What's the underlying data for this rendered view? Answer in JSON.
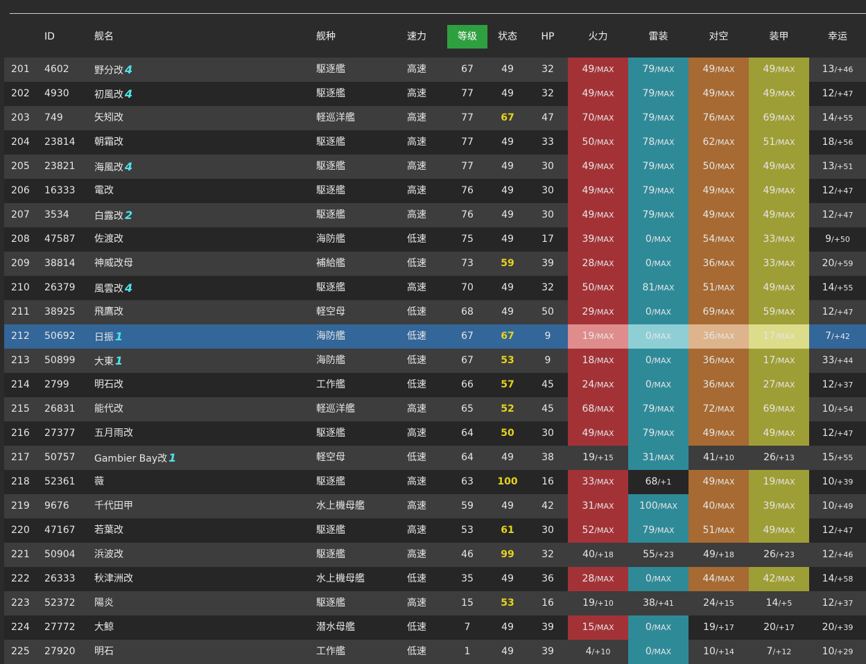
{
  "header": {
    "num": "",
    "id": "ID",
    "name": "舰名",
    "type": "舰种",
    "speed": "速力",
    "level": "等级",
    "cond": "状态",
    "hp": "HP",
    "fire": "火力",
    "torpedo": "雷装",
    "aa": "对空",
    "armor": "装甲",
    "luck": "幸运"
  },
  "colors": {
    "firepower": "#a33237",
    "torpedo": "#2f8a98",
    "antiair": "#a66a32",
    "armor": "#9e9e36",
    "selected_row": "#336699",
    "sorted_header": "#2fa040",
    "highlight_condition": "#e6d21c",
    "remodel_rank": "#4fe3e9"
  },
  "rows": [
    {
      "no": "201",
      "id": "4602",
      "name": "野分改",
      "rank": "4",
      "type": "駆逐艦",
      "speed": "高速",
      "lv": "67",
      "cond": "49",
      "hp": "32",
      "fire": [
        "49",
        "/MAX"
      ],
      "tor": [
        "79",
        "/MAX"
      ],
      "aa": [
        "49",
        "/MAX"
      ],
      "arm": [
        "49",
        "/MAX"
      ],
      "luck": [
        "13",
        "/+46"
      ],
      "hl": [
        1,
        1,
        1,
        1
      ]
    },
    {
      "no": "202",
      "id": "4930",
      "name": "初風改",
      "rank": "4",
      "type": "駆逐艦",
      "speed": "高速",
      "lv": "77",
      "cond": "49",
      "hp": "32",
      "fire": [
        "49",
        "/MAX"
      ],
      "tor": [
        "79",
        "/MAX"
      ],
      "aa": [
        "49",
        "/MAX"
      ],
      "arm": [
        "49",
        "/MAX"
      ],
      "luck": [
        "12",
        "/+47"
      ],
      "hl": [
        1,
        1,
        1,
        1
      ]
    },
    {
      "no": "203",
      "id": "749",
      "name": "矢矧改",
      "rank": "",
      "type": "軽巡洋艦",
      "speed": "高速",
      "lv": "77",
      "cond": "67",
      "hp": "47",
      "fire": [
        "70",
        "/MAX"
      ],
      "tor": [
        "79",
        "/MAX"
      ],
      "aa": [
        "76",
        "/MAX"
      ],
      "arm": [
        "69",
        "/MAX"
      ],
      "luck": [
        "14",
        "/+55"
      ],
      "hl": [
        1,
        1,
        1,
        1
      ]
    },
    {
      "no": "204",
      "id": "23814",
      "name": "朝霜改",
      "rank": "",
      "type": "駆逐艦",
      "speed": "高速",
      "lv": "77",
      "cond": "49",
      "hp": "33",
      "fire": [
        "50",
        "/MAX"
      ],
      "tor": [
        "78",
        "/MAX"
      ],
      "aa": [
        "62",
        "/MAX"
      ],
      "arm": [
        "51",
        "/MAX"
      ],
      "luck": [
        "18",
        "/+56"
      ],
      "hl": [
        1,
        1,
        1,
        1
      ]
    },
    {
      "no": "205",
      "id": "23821",
      "name": "海風改",
      "rank": "4",
      "type": "駆逐艦",
      "speed": "高速",
      "lv": "77",
      "cond": "49",
      "hp": "30",
      "fire": [
        "49",
        "/MAX"
      ],
      "tor": [
        "79",
        "/MAX"
      ],
      "aa": [
        "50",
        "/MAX"
      ],
      "arm": [
        "49",
        "/MAX"
      ],
      "luck": [
        "13",
        "/+51"
      ],
      "hl": [
        1,
        1,
        1,
        1
      ]
    },
    {
      "no": "206",
      "id": "16333",
      "name": "電改",
      "rank": "",
      "type": "駆逐艦",
      "speed": "高速",
      "lv": "76",
      "cond": "49",
      "hp": "30",
      "fire": [
        "49",
        "/MAX"
      ],
      "tor": [
        "79",
        "/MAX"
      ],
      "aa": [
        "49",
        "/MAX"
      ],
      "arm": [
        "49",
        "/MAX"
      ],
      "luck": [
        "12",
        "/+47"
      ],
      "hl": [
        1,
        1,
        1,
        1
      ]
    },
    {
      "no": "207",
      "id": "3534",
      "name": "白露改",
      "rank": "2",
      "type": "駆逐艦",
      "speed": "高速",
      "lv": "76",
      "cond": "49",
      "hp": "30",
      "fire": [
        "49",
        "/MAX"
      ],
      "tor": [
        "79",
        "/MAX"
      ],
      "aa": [
        "49",
        "/MAX"
      ],
      "arm": [
        "49",
        "/MAX"
      ],
      "luck": [
        "12",
        "/+47"
      ],
      "hl": [
        1,
        1,
        1,
        1
      ]
    },
    {
      "no": "208",
      "id": "47587",
      "name": "佐渡改",
      "rank": "",
      "type": "海防艦",
      "speed": "低速",
      "lv": "75",
      "cond": "49",
      "hp": "17",
      "fire": [
        "39",
        "/MAX"
      ],
      "tor": [
        "0",
        "/MAX"
      ],
      "aa": [
        "54",
        "/MAX"
      ],
      "arm": [
        "33",
        "/MAX"
      ],
      "luck": [
        "9",
        "/+50"
      ],
      "hl": [
        1,
        1,
        1,
        1
      ]
    },
    {
      "no": "209",
      "id": "38814",
      "name": "神威改母",
      "rank": "",
      "type": "補給艦",
      "speed": "低速",
      "lv": "73",
      "cond": "59",
      "hp": "39",
      "fire": [
        "28",
        "/MAX"
      ],
      "tor": [
        "0",
        "/MAX"
      ],
      "aa": [
        "36",
        "/MAX"
      ],
      "arm": [
        "33",
        "/MAX"
      ],
      "luck": [
        "20",
        "/+59"
      ],
      "hl": [
        1,
        1,
        1,
        1
      ]
    },
    {
      "no": "210",
      "id": "26379",
      "name": "風雲改",
      "rank": "4",
      "type": "駆逐艦",
      "speed": "高速",
      "lv": "70",
      "cond": "49",
      "hp": "32",
      "fire": [
        "50",
        "/MAX"
      ],
      "tor": [
        "81",
        "/MAX"
      ],
      "aa": [
        "51",
        "/MAX"
      ],
      "arm": [
        "49",
        "/MAX"
      ],
      "luck": [
        "14",
        "/+55"
      ],
      "hl": [
        1,
        1,
        1,
        1
      ]
    },
    {
      "no": "211",
      "id": "38925",
      "name": "飛鷹改",
      "rank": "",
      "type": "軽空母",
      "speed": "低速",
      "lv": "68",
      "cond": "49",
      "hp": "50",
      "fire": [
        "29",
        "/MAX"
      ],
      "tor": [
        "0",
        "/MAX"
      ],
      "aa": [
        "69",
        "/MAX"
      ],
      "arm": [
        "59",
        "/MAX"
      ],
      "luck": [
        "12",
        "/+47"
      ],
      "hl": [
        1,
        1,
        1,
        1
      ]
    },
    {
      "no": "212",
      "id": "50692",
      "name": "日振",
      "rank": "1",
      "type": "海防艦",
      "speed": "低速",
      "lv": "67",
      "cond": "67",
      "hp": "9",
      "fire": [
        "19",
        "/MAX"
      ],
      "tor": [
        "0",
        "/MAX"
      ],
      "aa": [
        "36",
        "/MAX"
      ],
      "arm": [
        "17",
        "/MAX"
      ],
      "luck": [
        "7",
        "/+42"
      ],
      "hl": [
        1,
        1,
        1,
        1
      ],
      "selected": true
    },
    {
      "no": "213",
      "id": "50899",
      "name": "大東",
      "rank": "1",
      "type": "海防艦",
      "speed": "低速",
      "lv": "67",
      "cond": "53",
      "hp": "9",
      "fire": [
        "18",
        "/MAX"
      ],
      "tor": [
        "0",
        "/MAX"
      ],
      "aa": [
        "36",
        "/MAX"
      ],
      "arm": [
        "17",
        "/MAX"
      ],
      "luck": [
        "33",
        "/+44"
      ],
      "hl": [
        1,
        1,
        1,
        1
      ]
    },
    {
      "no": "214",
      "id": "2799",
      "name": "明石改",
      "rank": "",
      "type": "工作艦",
      "speed": "低速",
      "lv": "66",
      "cond": "57",
      "hp": "45",
      "fire": [
        "24",
        "/MAX"
      ],
      "tor": [
        "0",
        "/MAX"
      ],
      "aa": [
        "36",
        "/MAX"
      ],
      "arm": [
        "27",
        "/MAX"
      ],
      "luck": [
        "12",
        "/+37"
      ],
      "hl": [
        1,
        1,
        1,
        1
      ]
    },
    {
      "no": "215",
      "id": "26831",
      "name": "能代改",
      "rank": "",
      "type": "軽巡洋艦",
      "speed": "高速",
      "lv": "65",
      "cond": "52",
      "hp": "45",
      "fire": [
        "68",
        "/MAX"
      ],
      "tor": [
        "79",
        "/MAX"
      ],
      "aa": [
        "72",
        "/MAX"
      ],
      "arm": [
        "69",
        "/MAX"
      ],
      "luck": [
        "10",
        "/+54"
      ],
      "hl": [
        1,
        1,
        1,
        1
      ]
    },
    {
      "no": "216",
      "id": "27377",
      "name": "五月雨改",
      "rank": "",
      "type": "駆逐艦",
      "speed": "高速",
      "lv": "64",
      "cond": "50",
      "hp": "30",
      "fire": [
        "49",
        "/MAX"
      ],
      "tor": [
        "79",
        "/MAX"
      ],
      "aa": [
        "49",
        "/MAX"
      ],
      "arm": [
        "49",
        "/MAX"
      ],
      "luck": [
        "12",
        "/+47"
      ],
      "hl": [
        1,
        1,
        1,
        1
      ]
    },
    {
      "no": "217",
      "id": "50757",
      "name": "Gambier Bay改",
      "rank": "1",
      "type": "軽空母",
      "speed": "低速",
      "lv": "64",
      "cond": "49",
      "hp": "38",
      "fire": [
        "19",
        "/+15"
      ],
      "tor": [
        "31",
        "/MAX"
      ],
      "aa": [
        "41",
        "/+10"
      ],
      "arm": [
        "26",
        "/+13"
      ],
      "luck": [
        "15",
        "/+55"
      ],
      "hl": [
        0,
        1,
        0,
        0
      ]
    },
    {
      "no": "218",
      "id": "52361",
      "name": "薇",
      "rank": "",
      "type": "駆逐艦",
      "speed": "高速",
      "lv": "63",
      "cond": "100",
      "hp": "16",
      "fire": [
        "33",
        "/MAX"
      ],
      "tor": [
        "68",
        "/+1"
      ],
      "aa": [
        "49",
        "/MAX"
      ],
      "arm": [
        "19",
        "/MAX"
      ],
      "luck": [
        "10",
        "/+39"
      ],
      "hl": [
        1,
        0,
        1,
        1
      ]
    },
    {
      "no": "219",
      "id": "9676",
      "name": "千代田甲",
      "rank": "",
      "type": "水上機母艦",
      "speed": "高速",
      "lv": "59",
      "cond": "49",
      "hp": "42",
      "fire": [
        "31",
        "/MAX"
      ],
      "tor": [
        "100",
        "/MAX"
      ],
      "aa": [
        "40",
        "/MAX"
      ],
      "arm": [
        "39",
        "/MAX"
      ],
      "luck": [
        "10",
        "/+49"
      ],
      "hl": [
        1,
        1,
        1,
        1
      ]
    },
    {
      "no": "220",
      "id": "47167",
      "name": "若葉改",
      "rank": "",
      "type": "駆逐艦",
      "speed": "高速",
      "lv": "53",
      "cond": "61",
      "hp": "30",
      "fire": [
        "52",
        "/MAX"
      ],
      "tor": [
        "79",
        "/MAX"
      ],
      "aa": [
        "51",
        "/MAX"
      ],
      "arm": [
        "49",
        "/MAX"
      ],
      "luck": [
        "12",
        "/+47"
      ],
      "hl": [
        1,
        1,
        1,
        1
      ]
    },
    {
      "no": "221",
      "id": "50904",
      "name": "浜波改",
      "rank": "",
      "type": "駆逐艦",
      "speed": "高速",
      "lv": "46",
      "cond": "99",
      "hp": "32",
      "fire": [
        "40",
        "/+18"
      ],
      "tor": [
        "55",
        "/+23"
      ],
      "aa": [
        "49",
        "/+18"
      ],
      "arm": [
        "26",
        "/+23"
      ],
      "luck": [
        "12",
        "/+46"
      ],
      "hl": [
        0,
        0,
        0,
        0
      ]
    },
    {
      "no": "222",
      "id": "26333",
      "name": "秋津洲改",
      "rank": "",
      "type": "水上機母艦",
      "speed": "低速",
      "lv": "35",
      "cond": "49",
      "hp": "36",
      "fire": [
        "28",
        "/MAX"
      ],
      "tor": [
        "0",
        "/MAX"
      ],
      "aa": [
        "44",
        "/MAX"
      ],
      "arm": [
        "42",
        "/MAX"
      ],
      "luck": [
        "14",
        "/+58"
      ],
      "hl": [
        1,
        1,
        1,
        1
      ]
    },
    {
      "no": "223",
      "id": "52372",
      "name": "陽炎",
      "rank": "",
      "type": "駆逐艦",
      "speed": "高速",
      "lv": "15",
      "cond": "53",
      "hp": "16",
      "fire": [
        "19",
        "/+10"
      ],
      "tor": [
        "38",
        "/+41"
      ],
      "aa": [
        "24",
        "/+15"
      ],
      "arm": [
        "14",
        "/+5"
      ],
      "luck": [
        "12",
        "/+37"
      ],
      "hl": [
        0,
        0,
        0,
        0
      ]
    },
    {
      "no": "224",
      "id": "27772",
      "name": "大鯨",
      "rank": "",
      "type": "潜水母艦",
      "speed": "低速",
      "lv": "7",
      "cond": "49",
      "hp": "39",
      "fire": [
        "15",
        "/MAX"
      ],
      "tor": [
        "0",
        "/MAX"
      ],
      "aa": [
        "19",
        "/+17"
      ],
      "arm": [
        "20",
        "/+17"
      ],
      "luck": [
        "20",
        "/+39"
      ],
      "hl": [
        1,
        1,
        0,
        0
      ]
    },
    {
      "no": "225",
      "id": "27920",
      "name": "明石",
      "rank": "",
      "type": "工作艦",
      "speed": "低速",
      "lv": "1",
      "cond": "49",
      "hp": "39",
      "fire": [
        "4",
        "/+10"
      ],
      "tor": [
        "0",
        "/MAX"
      ],
      "aa": [
        "10",
        "/+14"
      ],
      "arm": [
        "7",
        "/+12"
      ],
      "luck": [
        "10",
        "/+29"
      ],
      "hl": [
        0,
        1,
        0,
        0
      ]
    }
  ]
}
